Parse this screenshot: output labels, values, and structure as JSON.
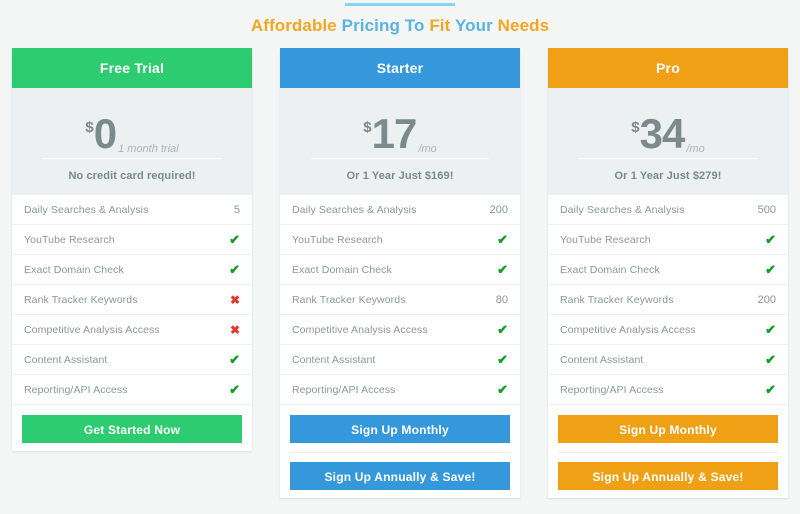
{
  "heading": {
    "parts": [
      {
        "text": "Affordable",
        "color": "orange"
      },
      {
        "text": "Pricing To",
        "color": "blue"
      },
      {
        "text": "Fit",
        "color": "orange"
      },
      {
        "text": "Your",
        "color": "blue"
      },
      {
        "text": "Needs",
        "color": "orange"
      }
    ],
    "full_text": "Affordable Pricing To Fit Your Needs"
  },
  "colors": {
    "free": "#2ecc71",
    "starter": "#3498db",
    "pro": "#f0a015",
    "heading_orange": "#f5a623",
    "heading_blue": "#5bb3e4",
    "divider_blue": "#89d4fb",
    "check_green": "#129c29",
    "cross_red": "#e23b2e"
  },
  "icons": {
    "check": "✔",
    "cross": "✖"
  },
  "plans": [
    {
      "name": "Free Trial",
      "currency": "$",
      "amount": "0",
      "suffix": "1 month trial",
      "note": "No credit card required!",
      "features": [
        {
          "label": "Daily Searches & Analysis",
          "value": "5",
          "type": "text"
        },
        {
          "label": "YouTube Research",
          "value": "✔",
          "type": "yes"
        },
        {
          "label": "Exact Domain Check",
          "value": "✔",
          "type": "yes"
        },
        {
          "label": "Rank Tracker Keywords",
          "value": "✖",
          "type": "no"
        },
        {
          "label": "Competitive Analysis Access",
          "value": "✖",
          "type": "no"
        },
        {
          "label": "Content Assistant",
          "value": "✔",
          "type": "yes"
        },
        {
          "label": "Reporting/API Access",
          "value": "✔",
          "type": "yes"
        }
      ],
      "buttons": [
        {
          "label": "Get Started Now"
        }
      ]
    },
    {
      "name": "Starter",
      "currency": "$",
      "amount": "17",
      "suffix": "/mo",
      "note": "Or 1 Year Just $169!",
      "features": [
        {
          "label": "Daily Searches & Analysis",
          "value": "200",
          "type": "text"
        },
        {
          "label": "YouTube Research",
          "value": "✔",
          "type": "yes"
        },
        {
          "label": "Exact Domain Check",
          "value": "✔",
          "type": "yes"
        },
        {
          "label": "Rank Tracker Keywords",
          "value": "80",
          "type": "text"
        },
        {
          "label": "Competitive Analysis Access",
          "value": "✔",
          "type": "yes"
        },
        {
          "label": "Content Assistant",
          "value": "✔",
          "type": "yes"
        },
        {
          "label": "Reporting/API Access",
          "value": "✔",
          "type": "yes"
        }
      ],
      "buttons": [
        {
          "label": "Sign Up Monthly"
        },
        {
          "label": "Sign Up Annually & Save!"
        }
      ]
    },
    {
      "name": "Pro",
      "currency": "$",
      "amount": "34",
      "suffix": "/mo",
      "note": "Or 1 Year Just $279!",
      "features": [
        {
          "label": "Daily Searches & Analysis",
          "value": "500",
          "type": "text"
        },
        {
          "label": "YouTube Research",
          "value": "✔",
          "type": "yes"
        },
        {
          "label": "Exact Domain Check",
          "value": "✔",
          "type": "yes"
        },
        {
          "label": "Rank Tracker Keywords",
          "value": "200",
          "type": "text"
        },
        {
          "label": "Competitive Analysis Access",
          "value": "✔",
          "type": "yes"
        },
        {
          "label": "Content Assistant",
          "value": "✔",
          "type": "yes"
        },
        {
          "label": "Reporting/API Access",
          "value": "✔",
          "type": "yes"
        }
      ],
      "buttons": [
        {
          "label": "Sign Up Monthly"
        },
        {
          "label": "Sign Up Annually & Save!"
        }
      ]
    }
  ]
}
